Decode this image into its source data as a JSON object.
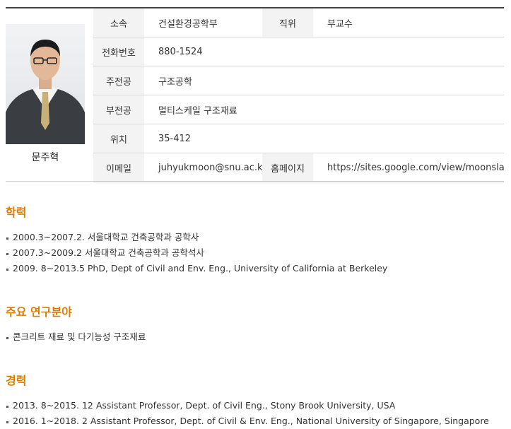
{
  "profile": {
    "name": "문주혁"
  },
  "info": {
    "rows": [
      [
        {
          "label": "소속",
          "value": "건설환경공학부"
        },
        {
          "label": "직위",
          "value": "부교수"
        }
      ],
      [
        {
          "label": "전화번호",
          "value": "880-1524"
        }
      ],
      [
        {
          "label": "주전공",
          "value": "구조공학"
        }
      ],
      [
        {
          "label": "부전공",
          "value": "멀티스케일 구조재료"
        }
      ],
      [
        {
          "label": "위치",
          "value": "35-412"
        }
      ],
      [
        {
          "label": "이메일",
          "value": "juhyukmoon@snu.ac.kr"
        },
        {
          "label": "홈페이지",
          "value": "https://sites.google.com/view/moonslab"
        }
      ]
    ]
  },
  "education": {
    "title": "학력",
    "items": [
      "2000.3~2007.2. 서울대학교 건축공학과 공학사",
      "2007.3~2009.2 서울대학교 건축공학과 공학석사",
      "2009. 8~2013.5 PhD, Dept of Civil and Env. Eng., University of California at Berkeley"
    ]
  },
  "research": {
    "title": "주요 연구분야",
    "items": [
      "콘크리트 재료 및 다기능성 구조재료"
    ]
  },
  "career": {
    "title": "경력",
    "items": [
      "2013. 8~2015. 12 Assistant Professor, Dept. of Civil Eng., Stony Brook University, USA",
      "2016. 1~2018. 2 Assistant Professor, Dept. of Civil & Env. Eng., National University of Singapore, Singapore"
    ]
  }
}
